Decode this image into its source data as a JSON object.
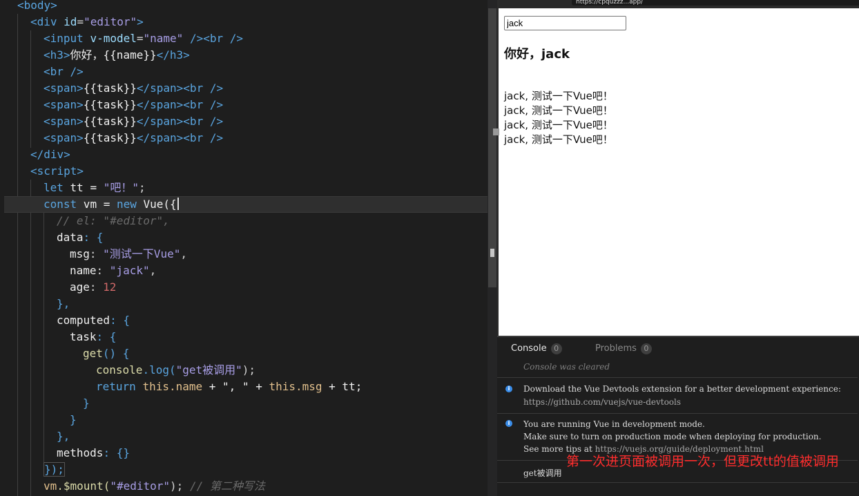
{
  "editor": {
    "lines": {
      "body_open": "<body>",
      "div_open_tag": "<div",
      "div_attr": "id",
      "div_eq": "=",
      "div_val": "\"editor\"",
      "div_close": ">",
      "input_tag": "<input",
      "input_attr": "v-model",
      "input_val": "\"name\"",
      "input_end": " /><br />",
      "h3_open": "<h3>",
      "h3_text": "你好，{{name}}",
      "h3_close": "</h3>",
      "br": "<br />",
      "span_open": "<span>",
      "span_text": "{{task}}",
      "span_close": "</span>",
      "span_br": "<br />",
      "div_end": "</div>",
      "script_open": "<script>",
      "let_kw": "let",
      "tt_var": " tt = ",
      "tt_val": "\"吧！\"",
      "tt_end": ";",
      "const_kw": "const",
      "vm_decl": " vm = ",
      "new_kw": "new",
      "vue_call": " Vue({",
      "el_comment": "// el: \"#editor\",",
      "data_key": "data",
      "obj_open": ": {",
      "msg_key": "msg",
      "msg_val": "\"测试一下Vue\"",
      "name_key": "name",
      "name_val": "\"jack\"",
      "age_key": "age",
      "age_val": "12",
      "obj_close_comma": "},",
      "computed_key": "computed",
      "task_key": "task",
      "get_fn": "get",
      "get_paren": "() {",
      "console_obj": "console",
      "log_fn": ".log(",
      "log_str": "\"get被调用\"",
      "log_end": ");",
      "return_kw": "return",
      "this1": "this",
      "name_ref": ".name",
      "plus_str": " + \", \" + ",
      "this2": "this",
      "msg_ref": ".msg",
      "plus_tt": " + tt;",
      "brace_close": "}",
      "methods_key": "methods",
      "methods_val": ": {}",
      "vue_end": "});",
      "mount_obj": "vm",
      "mount_fn": ".$mount(",
      "mount_arg": "\"#editor\"",
      "mount_end": ");",
      "mount_comment": "// 第二种写法",
      "colon_sp": ": ",
      "comma": ",",
      "colon_brace": ": {"
    }
  },
  "browser": {
    "url": "https://cpquzzz...app/",
    "input_value": "jack",
    "greeting": "你好，jack",
    "tasks": [
      "jack, 测试一下Vue吧！",
      "jack, 测试一下Vue吧！",
      "jack, 测试一下Vue吧！",
      "jack, 测试一下Vue吧！"
    ]
  },
  "devtools": {
    "tabs": [
      {
        "label": "Console",
        "count": "0"
      },
      {
        "label": "Problems",
        "count": "0"
      }
    ],
    "cleared": "Console was cleared",
    "messages": [
      {
        "line1": "Download the Vue Devtools extension for a better development experience:",
        "line2": "https://github.com/vuejs/vue-devtools"
      },
      {
        "line1": "You are running Vue in development mode.",
        "line2": "Make sure to turn on production mode when deploying for production.",
        "line3_prefix": "See more tips at ",
        "line3_url": "https://vuejs.org/guide/deployment.html"
      }
    ],
    "log_output": "get被调用",
    "annotation": "第一次进页面被调用一次，但更改tt的值被调用"
  },
  "colors": {
    "editor_bg": "#1e1e1e",
    "tag": "#5aa5e0",
    "string": "#ce9178",
    "annotation_red": "#ff2d2d",
    "info_blue": "#3b8eea"
  }
}
